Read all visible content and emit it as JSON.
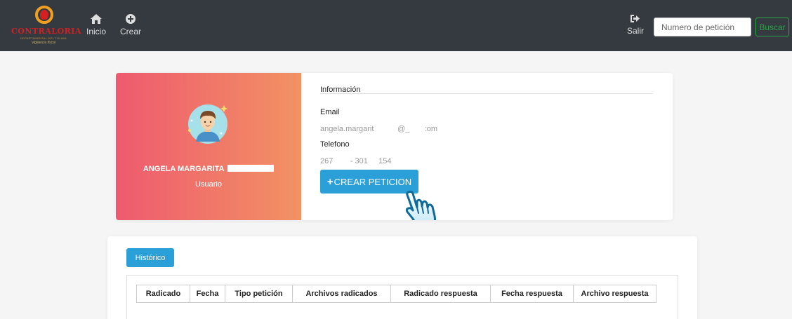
{
  "brand": {
    "logo_text": "CONTRALORIA",
    "logo_subtitle": "DEPARTAMENTAL DEL TOLIMA",
    "logo_tagline": "Vigilancia fiscal"
  },
  "nav": {
    "inicio": "Inicio",
    "crear": "Crear",
    "salir": "Salir"
  },
  "search": {
    "placeholder": "Numero de petición",
    "button": "Buscar"
  },
  "profile": {
    "name": "ANGELA MARGARITA",
    "role": "Usuario",
    "info_title": "Información",
    "email_label": "Email",
    "email_value": "angela.margarit           @_       :om",
    "phone_label": "Telefono",
    "phone_value": "267        - 301     154",
    "create_button": "CREAR PETICION"
  },
  "history": {
    "tab": "Histórico",
    "columns": [
      "Radicado",
      "Fecha",
      "Tipo petición",
      "Archivos radicados",
      "Radicado respuesta",
      "Fecha respuesta",
      "Archivo respuesta"
    ]
  },
  "colors": {
    "navbar": "#343a40",
    "accent": "#2b9fd8",
    "gradient_start": "#ee5a6f",
    "gradient_end": "#f29263",
    "search_button": "#28a745"
  },
  "icons": {
    "inicio": "home-icon",
    "crear": "plus-circle-icon",
    "salir": "sign-out-icon",
    "pointer": "hand-pointer-icon"
  }
}
